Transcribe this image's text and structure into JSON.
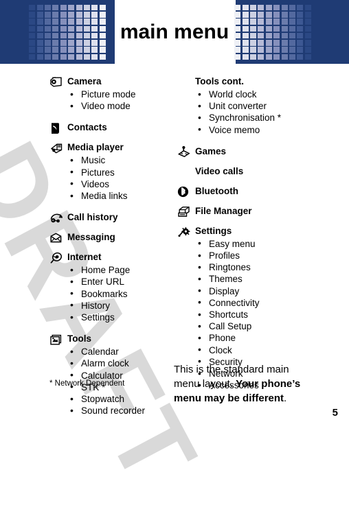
{
  "header": {
    "title": "main menu",
    "accent_color": "#1f3b74",
    "square_colors": [
      "#2b4884",
      "#3d5893",
      "#53699f",
      "#6b7cac",
      "#8690bc",
      "#9ea5c9",
      "#b6bad6",
      "#ccd0e2",
      "#dfe1ee",
      "#eef0f6"
    ]
  },
  "watermark": {
    "text": "DRAFT",
    "color": "#d9d9d9"
  },
  "left_column": [
    {
      "icon": "camera-icon",
      "label": "Camera",
      "items": [
        "Picture mode",
        "Video mode"
      ]
    },
    {
      "icon": "contacts-icon",
      "label": "Contacts",
      "items": []
    },
    {
      "icon": "media-player-icon",
      "label": "Media player",
      "items": [
        "Music",
        "Pictures",
        "Videos",
        "Media links"
      ]
    },
    {
      "icon": "call-history-icon",
      "label": "Call history",
      "items": []
    },
    {
      "icon": "messaging-icon",
      "label": "Messaging",
      "items": []
    },
    {
      "icon": "internet-icon",
      "label": "Internet",
      "items": [
        "Home Page",
        "Enter URL",
        "Bookmarks",
        "History",
        "Settings"
      ]
    },
    {
      "icon": "tools-icon",
      "label": "Tools",
      "items": [
        "Calendar",
        "Alarm clock",
        "Calculator",
        "STK *",
        "Stopwatch",
        "Sound recorder"
      ]
    }
  ],
  "right_column": [
    {
      "icon": "none",
      "label": "Tools cont.",
      "items": [
        "World clock",
        "Unit converter",
        "Synchronisation *",
        "Voice memo"
      ]
    },
    {
      "icon": "games-icon",
      "label": "Games",
      "items": []
    },
    {
      "icon": "none",
      "label": "Video calls",
      "items": []
    },
    {
      "icon": "bluetooth-icon",
      "label": "Bluetooth",
      "items": []
    },
    {
      "icon": "file-manager-icon",
      "label": "File Manager",
      "items": []
    },
    {
      "icon": "settings-icon",
      "label": "Settings",
      "items": [
        "Easy menu",
        "Profiles",
        "Ringtones",
        "Themes",
        "Display",
        "Connectivity",
        "Shortcuts",
        "Call Setup",
        "Phone",
        "Clock",
        "Security",
        "Network",
        "Accessories"
      ]
    }
  ],
  "footer": {
    "footnote": "* Network Dependent",
    "note_plain_1": "This is the standard main menu layout. ",
    "note_bold": "Your phone’s menu may be different",
    "note_plain_2": ".",
    "page_number": "5"
  }
}
